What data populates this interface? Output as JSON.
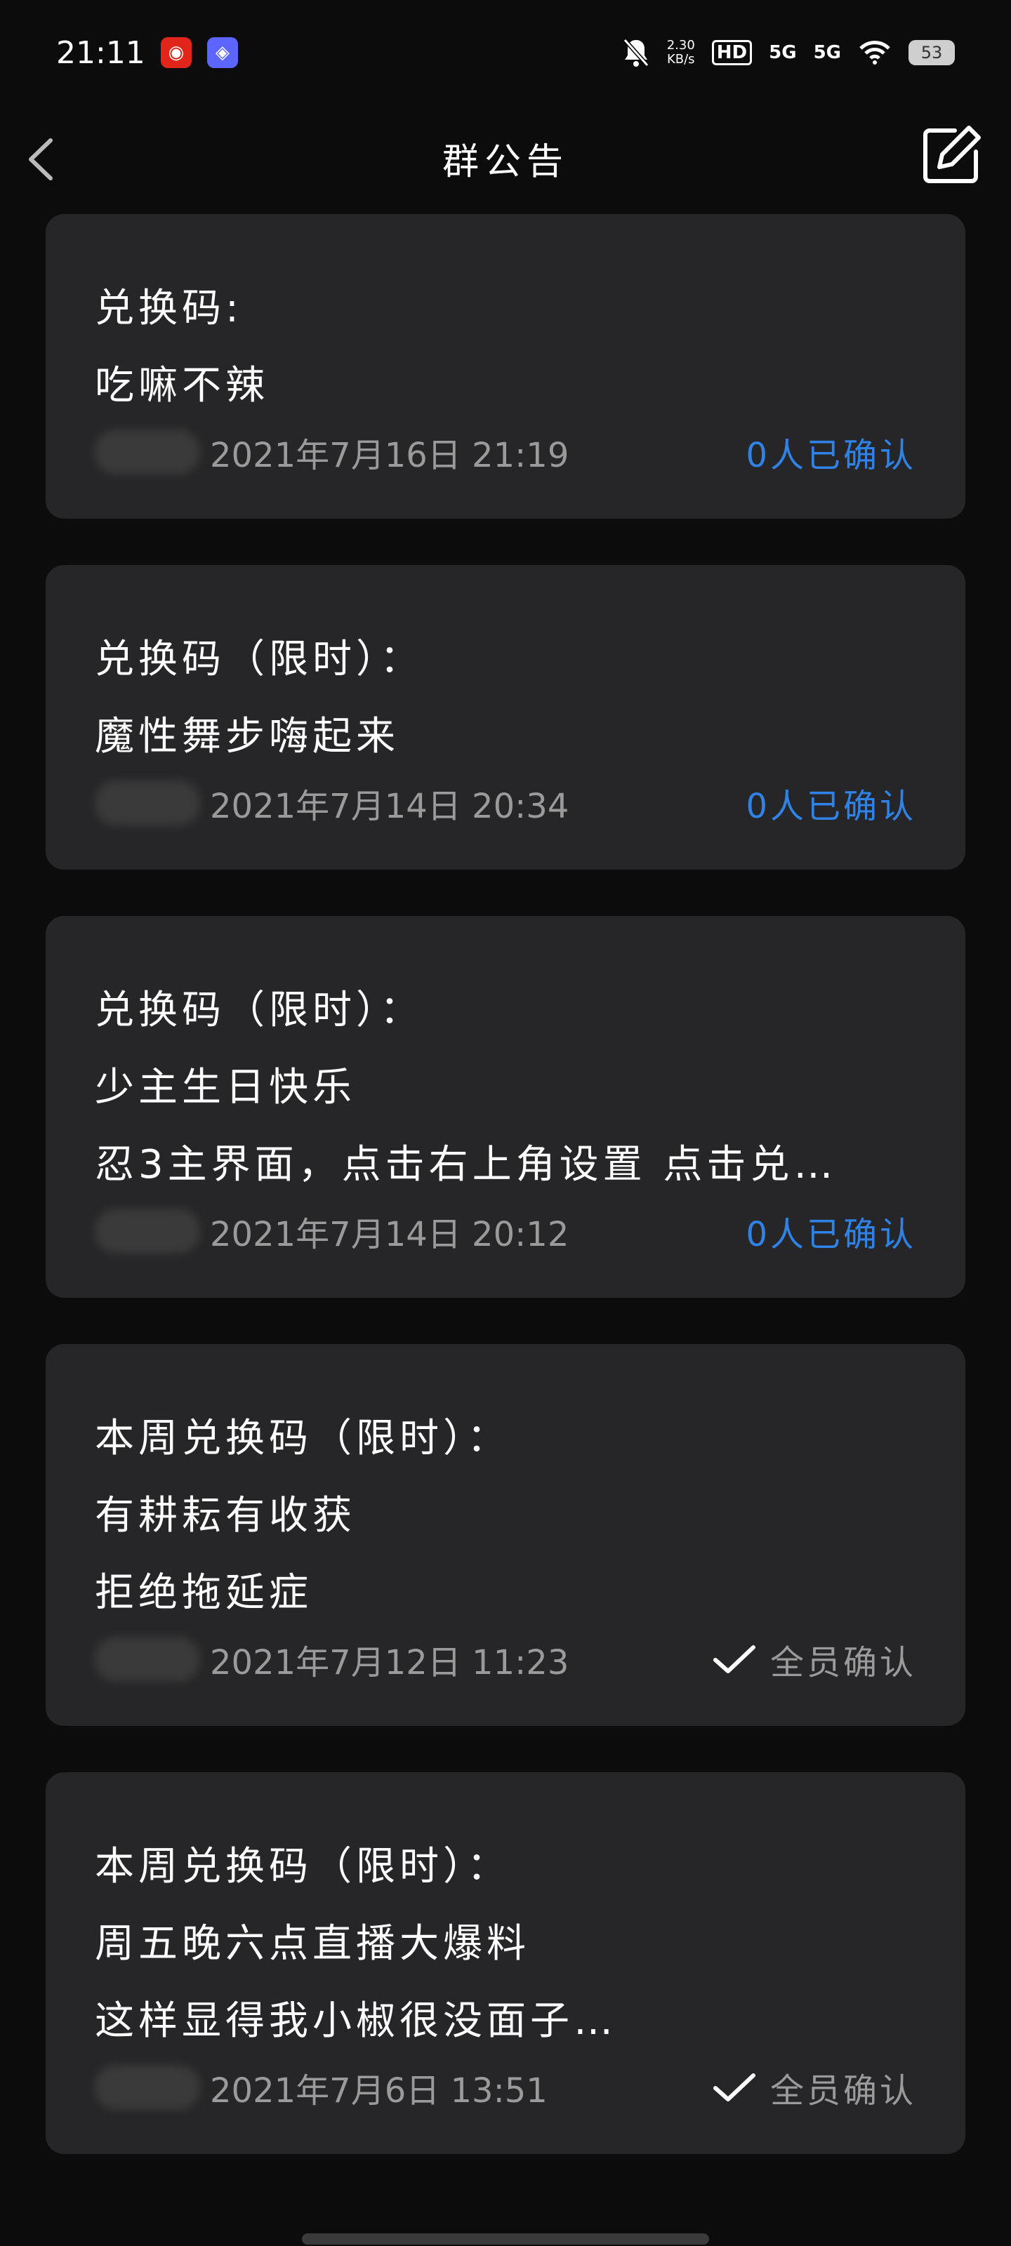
{
  "status_bar": {
    "time": "21:11",
    "network_speed_value": "2.30",
    "network_speed_unit": "KB/s",
    "hd_label": "HD",
    "signal_1": "5G",
    "signal_2": "5G",
    "battery": "53",
    "icons": [
      "netease-music-icon",
      "app-icon",
      "mute-bell-icon",
      "wifi-icon",
      "battery-icon"
    ]
  },
  "navbar": {
    "title": "群公告",
    "back_icon": "chevron-left-icon",
    "edit_icon": "edit-icon"
  },
  "announcements": [
    {
      "lines": [
        "兑换码:",
        "吃嘛不辣"
      ],
      "date": "2021年7月16日 21:19",
      "status": "0人已确认",
      "all_confirmed": false
    },
    {
      "lines": [
        "兑换码（限时）：",
        "魔性舞步嗨起来"
      ],
      "date": "2021年7月14日 20:34",
      "status": "0人已确认",
      "all_confirmed": false
    },
    {
      "lines": [
        "兑换码（限时）：",
        "少主生日快乐",
        "忍3主界面，点击右上角设置 点击兑…"
      ],
      "date": "2021年7月14日 20:12",
      "status": "0人已确认",
      "all_confirmed": false
    },
    {
      "lines": [
        "本周兑换码（限时）：",
        "有耕耘有收获",
        "拒绝拖延症"
      ],
      "date": "2021年7月12日 11:23",
      "status": "全员确认",
      "all_confirmed": true
    },
    {
      "lines": [
        "本周兑换码（限时）：",
        "周五晚六点直播大爆料",
        "这样显得我小椒很没面子…"
      ],
      "date": "2021年7月6日 13:51",
      "status": "全员确认",
      "all_confirmed": true
    }
  ],
  "colors": {
    "background": "#0c0c0c",
    "card": "#262628",
    "link_blue": "#2f82e6",
    "muted_text": "#9a9a9a"
  }
}
